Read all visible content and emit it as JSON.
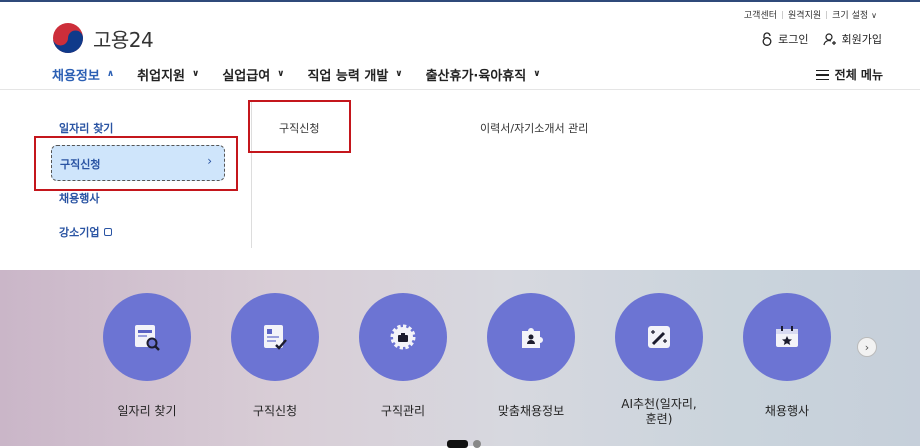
{
  "utility": [
    "고객센터",
    "원격지원",
    "크기 설정"
  ],
  "logo": {
    "name": "고용24"
  },
  "auth": {
    "login": "로그인",
    "signup": "회원가입"
  },
  "gnb": [
    "채용정보",
    "취업지원",
    "실업급여",
    "직업 능력 개발",
    "출산휴가·육아휴직"
  ],
  "full_menu": "전체 메뉴",
  "submenu": {
    "left": [
      "일자리 찾기",
      "구직신청",
      "채용행사",
      "강소기업"
    ],
    "middle": [
      "구직신청",
      "이력서/자기소개서 관리"
    ]
  },
  "services": [
    "일자리 찾기",
    "구직신청",
    "구직관리",
    "맞춤채용정보",
    "AI추천(일자리,\n훈련)",
    "채용행사"
  ],
  "colors": {
    "accent": "#2b5fb4",
    "highlight": "#c4161c",
    "service_circle": "#6c74d3"
  }
}
